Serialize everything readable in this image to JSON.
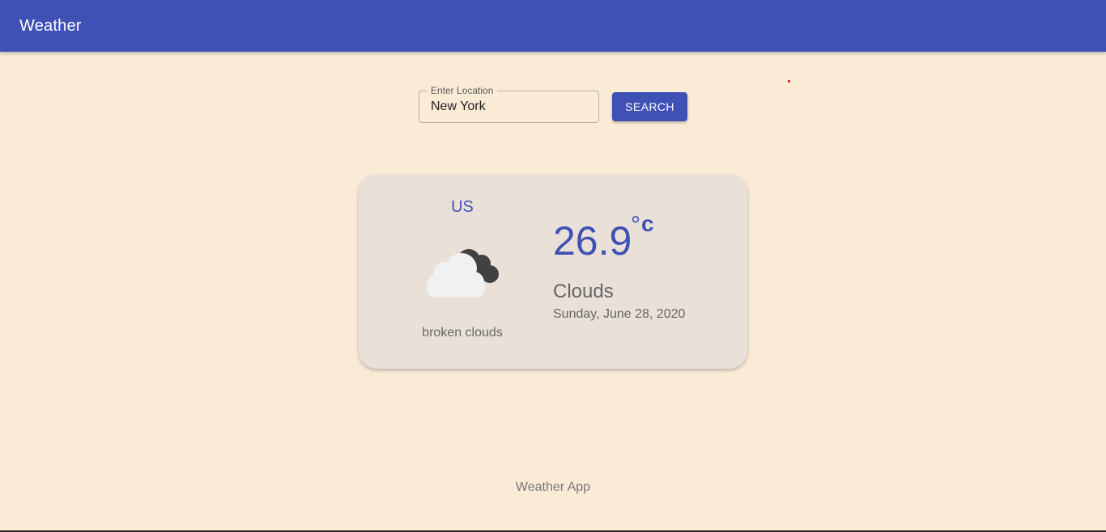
{
  "app_bar": {
    "title": "Weather"
  },
  "search": {
    "label": "Enter Location",
    "value": "New York",
    "button_label": "SEARCH"
  },
  "weather": {
    "country": "US",
    "icon": "broken-clouds-icon",
    "description": "broken clouds",
    "temperature": "26.9",
    "unit_degree": "°",
    "unit_symbol": "c",
    "condition": "Clouds",
    "date": "Sunday, June 28, 2020"
  },
  "footer": {
    "text": "Weather App"
  },
  "colors": {
    "primary": "#3f51b5",
    "background": "#faebd7",
    "card": "#e9e1d7"
  }
}
